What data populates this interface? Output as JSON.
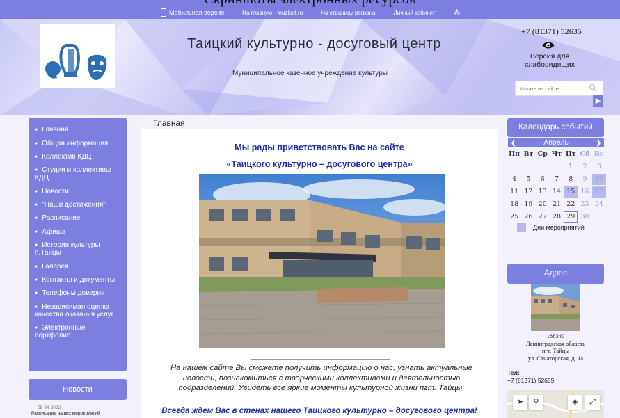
{
  "browser": {
    "partial_heading": "Скриншоты электронных ресурсов"
  },
  "topbar": {
    "mobile_label": "Мобильная версия",
    "links": [
      "На главную - muzkult.ru",
      "На страницу региона",
      "Личный кабинет"
    ],
    "sitemap_glyph": "⁂"
  },
  "header": {
    "title": "Таицкий культурно - досуговый центр",
    "subtitle": "Муниципальное казенное учреждение культуры",
    "phone": "+7 (81371) 52635",
    "vision_label": "Версия для слабовидящих",
    "search_placeholder": "Искать на сайте...",
    "search_go": "▶"
  },
  "sidebar": {
    "items": [
      {
        "label": "Главная"
      },
      {
        "label": "Общая информация"
      },
      {
        "label": "Коллектив КДЦ"
      },
      {
        "label": "Студии и коллективы КДЦ"
      },
      {
        "label": "Новости"
      },
      {
        "label": "\"Наши достижения\""
      },
      {
        "label": "Расписание"
      },
      {
        "label": "Афиша"
      },
      {
        "label": "История культуры п.Тайцы"
      },
      {
        "label": "Галерея"
      },
      {
        "label": "Контакты и документы"
      },
      {
        "label": "Телефоны доверия"
      },
      {
        "label": "Независимая оценка качества оказания услуг"
      },
      {
        "label": "Электронные портфолио"
      }
    ],
    "news": {
      "title": "Новости",
      "date": "05-04-2022",
      "headline": "Расписание наших мероприятий"
    }
  },
  "main": {
    "heading": "Главная",
    "welcome_line1": "Мы рады приветствовать Вас на сайте",
    "welcome_line2": "«Таицкого  культурно – досугового центра»",
    "intro": "На нашем сайте Вы сможете получить информацию о нас, узнать актуальные новости, познакомиться с творческими коллективами и деятельностью подразделений. Увидеть все яркие моменты культурной жизни пгт. Тайцы.",
    "closing": "Всегда ждем Вас в стенах нашего Таицкого культурно – досугового центра!"
  },
  "calendar": {
    "title": "Календарь событий",
    "month": "Апрель",
    "weekdays": [
      "Пн",
      "Вт",
      "Ср",
      "Чт",
      "Пт",
      "Сб",
      "Вс"
    ],
    "weeks": [
      [
        "",
        "",
        "",
        "",
        "1",
        "2",
        "3"
      ],
      [
        "4",
        "5",
        "6",
        "7",
        "8",
        "9",
        "10"
      ],
      [
        "11",
        "12",
        "13",
        "14",
        "15",
        "16",
        "17"
      ],
      [
        "18",
        "19",
        "20",
        "21",
        "22",
        "23",
        "24"
      ],
      [
        "25",
        "26",
        "27",
        "28",
        "29",
        "30",
        ""
      ]
    ],
    "event_days": [
      "10",
      "15",
      "17"
    ],
    "today": "29",
    "legend": "Дни мероприятий",
    "weekend_color": "#9a9de6",
    "event_color": "#b8b9ee"
  },
  "address": {
    "title": "Адрес",
    "lines": [
      "188340",
      "Ленинградская область",
      "пгт. Тайцы",
      "ул. Санаторская, д. 1а"
    ],
    "tel_label": "Тел:",
    "tel": "+7 (81371) 52635"
  },
  "map": {
    "locate_glyph": "➤",
    "search_glyph": "⚲",
    "layers_glyph": "◈",
    "expand_glyph": "⤢"
  },
  "colors": {
    "accent": "#7d7fe0",
    "link_blue": "#1b2fa8"
  }
}
